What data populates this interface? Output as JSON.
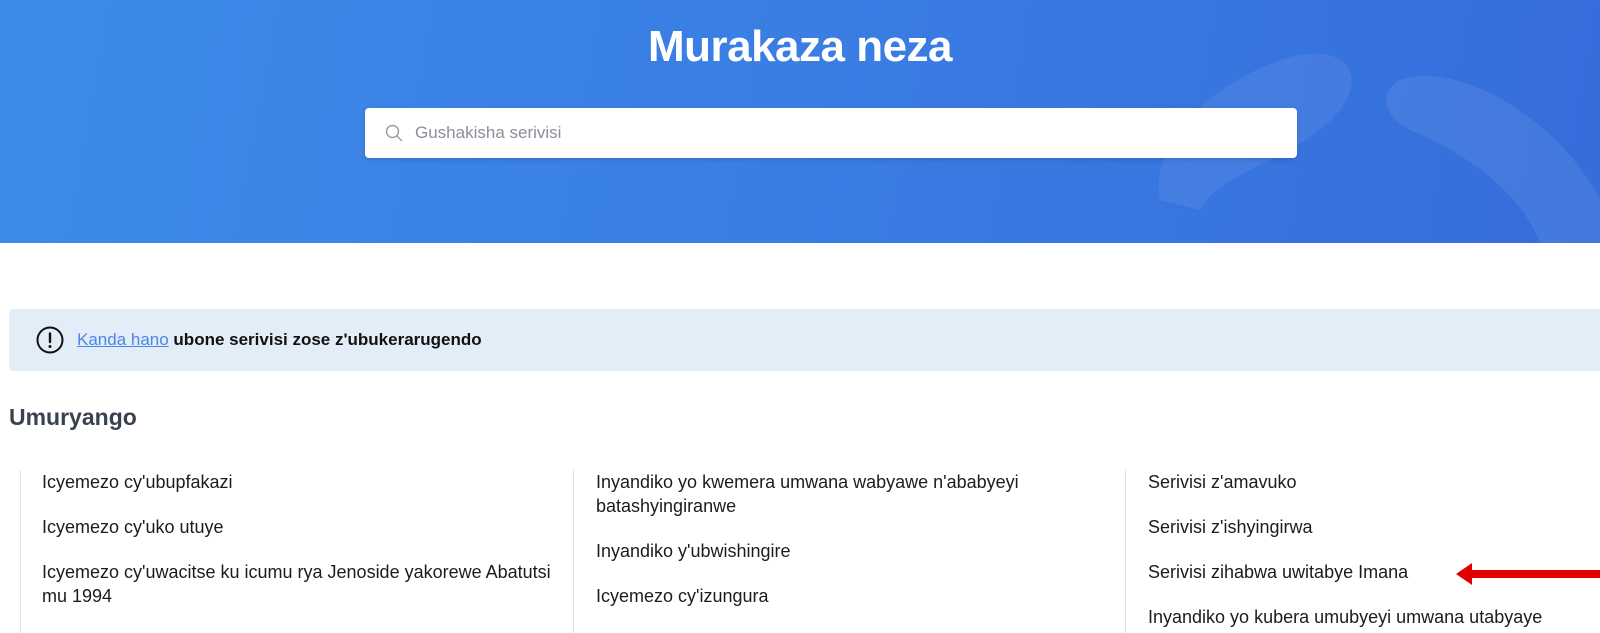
{
  "hero": {
    "title": "Murakaza neza",
    "search_placeholder": "Gushakisha serivisi",
    "search_icon": "search-icon"
  },
  "notice": {
    "icon": "exclamation-circle-icon",
    "link_label": "Kanda hano",
    "text": " ubone serivisi zose z'ubukerarugendo"
  },
  "section": {
    "title": "Umuryango"
  },
  "columns": [
    {
      "items": [
        {
          "label": "Icyemezo cy'ubupfakazi"
        },
        {
          "label": "Icyemezo cy'uko utuye"
        },
        {
          "label": "Icyemezo cy'uwacitse ku icumu rya Jenoside yakorewe Abatutsi mu 1994"
        }
      ]
    },
    {
      "items": [
        {
          "label": "Inyandiko yo kwemera umwana wabyawe n'ababyeyi batashyingiranwe"
        },
        {
          "label": "Inyandiko y'ubwishingire"
        },
        {
          "label": "Icyemezo cy'izungura"
        }
      ]
    },
    {
      "items": [
        {
          "label": "Serivisi z'amavuko"
        },
        {
          "label": "Serivisi z'ishyingirwa"
        },
        {
          "label": "Serivisi zihabwa uwitabye Imana"
        },
        {
          "label": "Inyandiko yo kubera umubyeyi umwana utabyaye"
        }
      ]
    }
  ],
  "annotation": {
    "icon": "red-arrow-left-icon",
    "color": "#e00000"
  }
}
